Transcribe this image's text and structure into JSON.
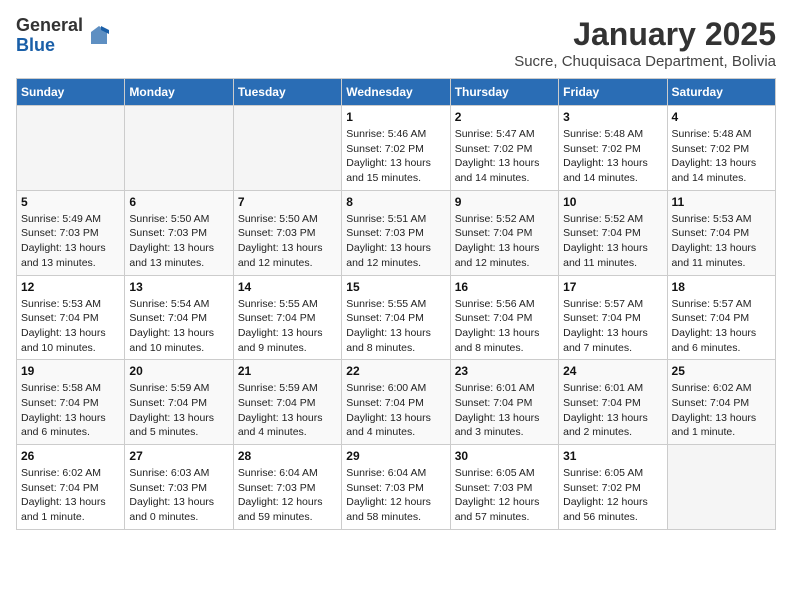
{
  "logo": {
    "general": "General",
    "blue": "Blue"
  },
  "header": {
    "month": "January 2025",
    "location": "Sucre, Chuquisaca Department, Bolivia"
  },
  "days_of_week": [
    "Sunday",
    "Monday",
    "Tuesday",
    "Wednesday",
    "Thursday",
    "Friday",
    "Saturday"
  ],
  "weeks": [
    [
      {
        "day": "",
        "sunrise": "",
        "sunset": "",
        "daylight": ""
      },
      {
        "day": "",
        "sunrise": "",
        "sunset": "",
        "daylight": ""
      },
      {
        "day": "",
        "sunrise": "",
        "sunset": "",
        "daylight": ""
      },
      {
        "day": "1",
        "sunrise": "Sunrise: 5:46 AM",
        "sunset": "Sunset: 7:02 PM",
        "daylight": "Daylight: 13 hours and 15 minutes."
      },
      {
        "day": "2",
        "sunrise": "Sunrise: 5:47 AM",
        "sunset": "Sunset: 7:02 PM",
        "daylight": "Daylight: 13 hours and 14 minutes."
      },
      {
        "day": "3",
        "sunrise": "Sunrise: 5:48 AM",
        "sunset": "Sunset: 7:02 PM",
        "daylight": "Daylight: 13 hours and 14 minutes."
      },
      {
        "day": "4",
        "sunrise": "Sunrise: 5:48 AM",
        "sunset": "Sunset: 7:02 PM",
        "daylight": "Daylight: 13 hours and 14 minutes."
      }
    ],
    [
      {
        "day": "5",
        "sunrise": "Sunrise: 5:49 AM",
        "sunset": "Sunset: 7:03 PM",
        "daylight": "Daylight: 13 hours and 13 minutes."
      },
      {
        "day": "6",
        "sunrise": "Sunrise: 5:50 AM",
        "sunset": "Sunset: 7:03 PM",
        "daylight": "Daylight: 13 hours and 13 minutes."
      },
      {
        "day": "7",
        "sunrise": "Sunrise: 5:50 AM",
        "sunset": "Sunset: 7:03 PM",
        "daylight": "Daylight: 13 hours and 12 minutes."
      },
      {
        "day": "8",
        "sunrise": "Sunrise: 5:51 AM",
        "sunset": "Sunset: 7:03 PM",
        "daylight": "Daylight: 13 hours and 12 minutes."
      },
      {
        "day": "9",
        "sunrise": "Sunrise: 5:52 AM",
        "sunset": "Sunset: 7:04 PM",
        "daylight": "Daylight: 13 hours and 12 minutes."
      },
      {
        "day": "10",
        "sunrise": "Sunrise: 5:52 AM",
        "sunset": "Sunset: 7:04 PM",
        "daylight": "Daylight: 13 hours and 11 minutes."
      },
      {
        "day": "11",
        "sunrise": "Sunrise: 5:53 AM",
        "sunset": "Sunset: 7:04 PM",
        "daylight": "Daylight: 13 hours and 11 minutes."
      }
    ],
    [
      {
        "day": "12",
        "sunrise": "Sunrise: 5:53 AM",
        "sunset": "Sunset: 7:04 PM",
        "daylight": "Daylight: 13 hours and 10 minutes."
      },
      {
        "day": "13",
        "sunrise": "Sunrise: 5:54 AM",
        "sunset": "Sunset: 7:04 PM",
        "daylight": "Daylight: 13 hours and 10 minutes."
      },
      {
        "day": "14",
        "sunrise": "Sunrise: 5:55 AM",
        "sunset": "Sunset: 7:04 PM",
        "daylight": "Daylight: 13 hours and 9 minutes."
      },
      {
        "day": "15",
        "sunrise": "Sunrise: 5:55 AM",
        "sunset": "Sunset: 7:04 PM",
        "daylight": "Daylight: 13 hours and 8 minutes."
      },
      {
        "day": "16",
        "sunrise": "Sunrise: 5:56 AM",
        "sunset": "Sunset: 7:04 PM",
        "daylight": "Daylight: 13 hours and 8 minutes."
      },
      {
        "day": "17",
        "sunrise": "Sunrise: 5:57 AM",
        "sunset": "Sunset: 7:04 PM",
        "daylight": "Daylight: 13 hours and 7 minutes."
      },
      {
        "day": "18",
        "sunrise": "Sunrise: 5:57 AM",
        "sunset": "Sunset: 7:04 PM",
        "daylight": "Daylight: 13 hours and 6 minutes."
      }
    ],
    [
      {
        "day": "19",
        "sunrise": "Sunrise: 5:58 AM",
        "sunset": "Sunset: 7:04 PM",
        "daylight": "Daylight: 13 hours and 6 minutes."
      },
      {
        "day": "20",
        "sunrise": "Sunrise: 5:59 AM",
        "sunset": "Sunset: 7:04 PM",
        "daylight": "Daylight: 13 hours and 5 minutes."
      },
      {
        "day": "21",
        "sunrise": "Sunrise: 5:59 AM",
        "sunset": "Sunset: 7:04 PM",
        "daylight": "Daylight: 13 hours and 4 minutes."
      },
      {
        "day": "22",
        "sunrise": "Sunrise: 6:00 AM",
        "sunset": "Sunset: 7:04 PM",
        "daylight": "Daylight: 13 hours and 4 minutes."
      },
      {
        "day": "23",
        "sunrise": "Sunrise: 6:01 AM",
        "sunset": "Sunset: 7:04 PM",
        "daylight": "Daylight: 13 hours and 3 minutes."
      },
      {
        "day": "24",
        "sunrise": "Sunrise: 6:01 AM",
        "sunset": "Sunset: 7:04 PM",
        "daylight": "Daylight: 13 hours and 2 minutes."
      },
      {
        "day": "25",
        "sunrise": "Sunrise: 6:02 AM",
        "sunset": "Sunset: 7:04 PM",
        "daylight": "Daylight: 13 hours and 1 minute."
      }
    ],
    [
      {
        "day": "26",
        "sunrise": "Sunrise: 6:02 AM",
        "sunset": "Sunset: 7:04 PM",
        "daylight": "Daylight: 13 hours and 1 minute."
      },
      {
        "day": "27",
        "sunrise": "Sunrise: 6:03 AM",
        "sunset": "Sunset: 7:03 PM",
        "daylight": "Daylight: 13 hours and 0 minutes."
      },
      {
        "day": "28",
        "sunrise": "Sunrise: 6:04 AM",
        "sunset": "Sunset: 7:03 PM",
        "daylight": "Daylight: 12 hours and 59 minutes."
      },
      {
        "day": "29",
        "sunrise": "Sunrise: 6:04 AM",
        "sunset": "Sunset: 7:03 PM",
        "daylight": "Daylight: 12 hours and 58 minutes."
      },
      {
        "day": "30",
        "sunrise": "Sunrise: 6:05 AM",
        "sunset": "Sunset: 7:03 PM",
        "daylight": "Daylight: 12 hours and 57 minutes."
      },
      {
        "day": "31",
        "sunrise": "Sunrise: 6:05 AM",
        "sunset": "Sunset: 7:02 PM",
        "daylight": "Daylight: 12 hours and 56 minutes."
      },
      {
        "day": "",
        "sunrise": "",
        "sunset": "",
        "daylight": ""
      }
    ]
  ]
}
